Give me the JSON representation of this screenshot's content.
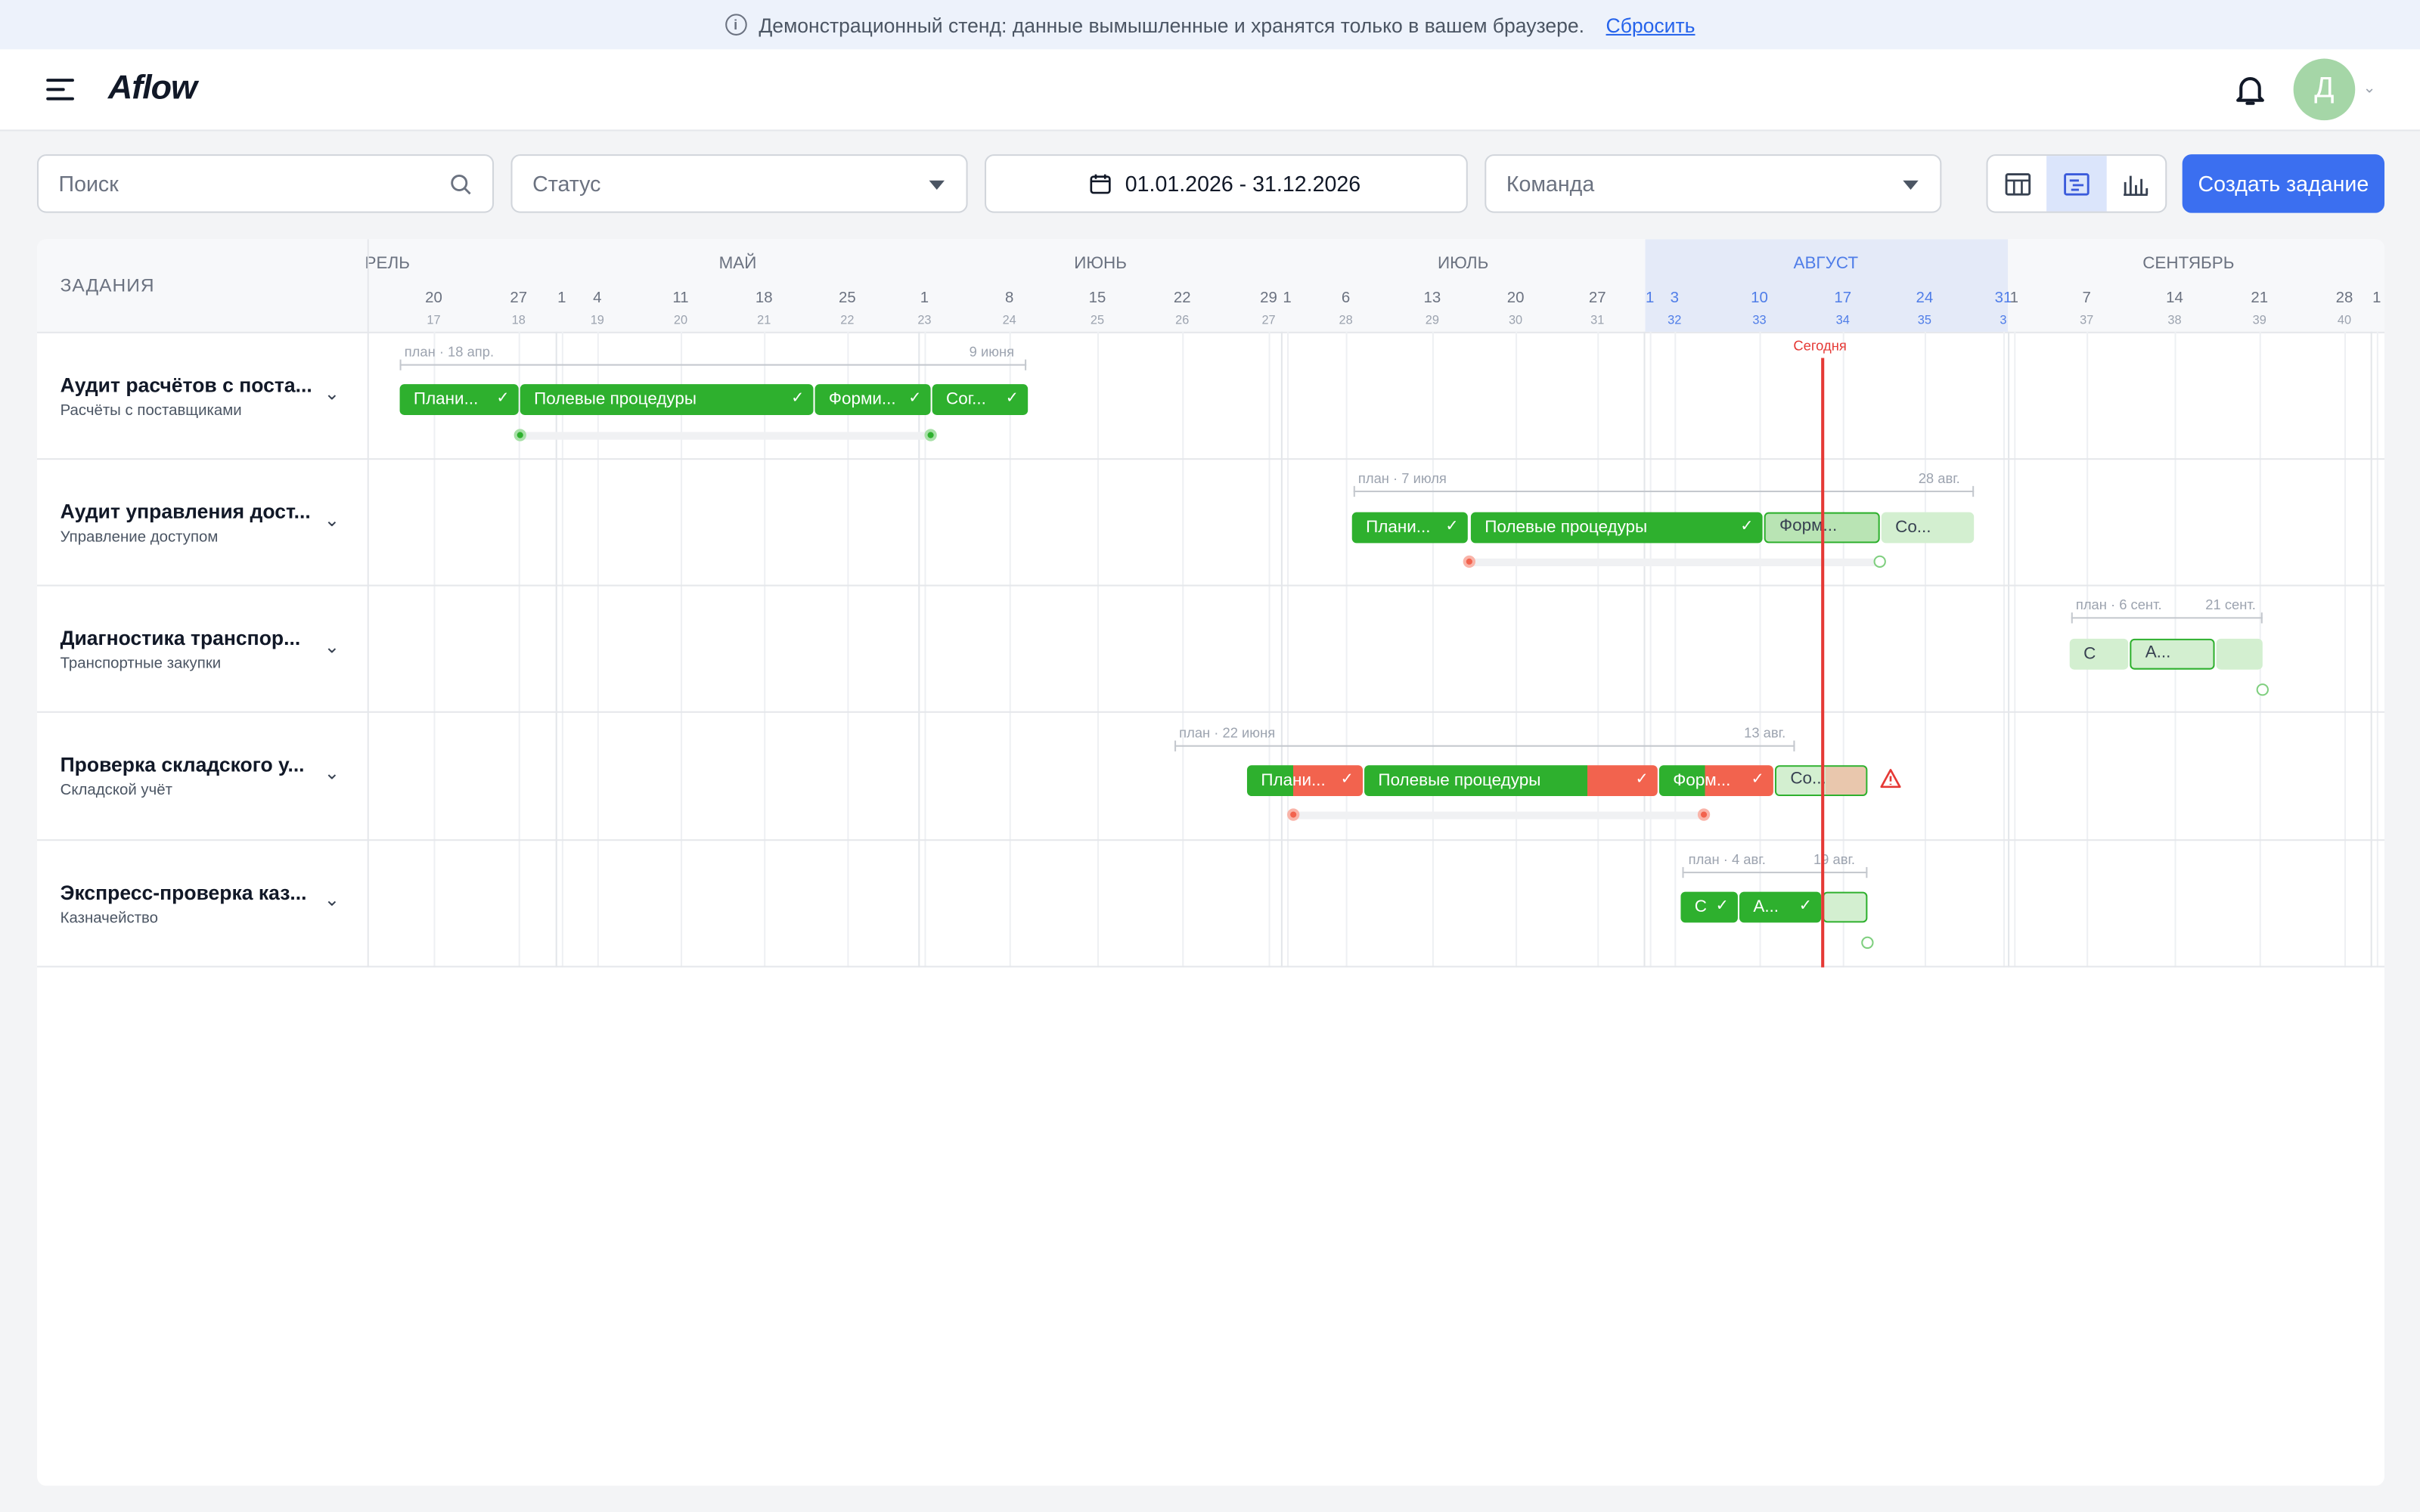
{
  "banner": {
    "text": "Демонстрационный стенд: данные вымышленные и хранятся только в вашем браузере.",
    "reset": "Сбросить"
  },
  "header": {
    "logo": "Aflow",
    "avatar_initial": "Д"
  },
  "toolbar": {
    "search_placeholder": "Поиск",
    "status_placeholder": "Статус",
    "date_range": "01.01.2026 - 31.12.2026",
    "team_placeholder": "Команда",
    "create_label": "Создать задание"
  },
  "gantt": {
    "tasks_header": "ЗАДАНИЯ",
    "today_label": "Сегодня",
    "months": [
      "РЕЛЬ",
      "МАЙ",
      "ИЮНЬ",
      "ИЮЛЬ",
      "АВГУСТ",
      "СЕНТЯБРЬ"
    ],
    "weeks": [
      {
        "d": "20",
        "n": "17"
      },
      {
        "d": "27",
        "n": "18"
      },
      {
        "d": "1",
        "n": ""
      },
      {
        "d": "4",
        "n": "19"
      },
      {
        "d": "11",
        "n": "20"
      },
      {
        "d": "18",
        "n": "21"
      },
      {
        "d": "25",
        "n": "22"
      },
      {
        "d": "1",
        "n": "23"
      },
      {
        "d": "8",
        "n": "24"
      },
      {
        "d": "15",
        "n": "25"
      },
      {
        "d": "22",
        "n": "26"
      },
      {
        "d": "29",
        "n": "27"
      },
      {
        "d": "1",
        "n": ""
      },
      {
        "d": "6",
        "n": "28"
      },
      {
        "d": "13",
        "n": "29"
      },
      {
        "d": "20",
        "n": "30"
      },
      {
        "d": "27",
        "n": "31"
      },
      {
        "d": "1",
        "n": ""
      },
      {
        "d": "3",
        "n": "32"
      },
      {
        "d": "10",
        "n": "33"
      },
      {
        "d": "17",
        "n": "34"
      },
      {
        "d": "24",
        "n": "35"
      },
      {
        "d": "31",
        "n": "3"
      },
      {
        "d": "1",
        "n": ""
      },
      {
        "d": "7",
        "n": "37"
      },
      {
        "d": "14",
        "n": "38"
      },
      {
        "d": "21",
        "n": "39"
      },
      {
        "d": "28",
        "n": "40"
      },
      {
        "d": "1",
        "n": ""
      }
    ],
    "rows": [
      {
        "title": "Аудит расчётов с поста...",
        "subtitle": "Расчёты с поставщиками",
        "plan_start": "план · 18 апр.",
        "plan_end": "9 июня",
        "segments": [
          "Плани...",
          "Полевые процедуры",
          "Форми...",
          "Сог..."
        ]
      },
      {
        "title": "Аудит управления дост...",
        "subtitle": "Управление доступом",
        "plan_start": "план · 7 июля",
        "plan_end": "28 авг.",
        "segments": [
          "Плани...",
          "Полевые процедуры",
          "Форм...",
          "Со..."
        ]
      },
      {
        "title": "Диагностика транспор...",
        "subtitle": "Транспортные закупки",
        "plan_start": "план · 6 сент.",
        "plan_end": "21 сент.",
        "segments": [
          "С",
          "А...",
          ""
        ]
      },
      {
        "title": "Проверка складского у...",
        "subtitle": "Складской учёт",
        "plan_start": "план · 22 июня",
        "plan_end": "13 авг.",
        "segments": [
          "Плани...",
          "Полевые процедуры",
          "Форм...",
          "Со..."
        ]
      },
      {
        "title": "Экспресс-проверка каз...",
        "subtitle": "Казначейство",
        "plan_start": "план · 4 авг.",
        "plan_end": "19 авг.",
        "segments": [
          "С",
          "А...",
          ""
        ]
      }
    ]
  }
}
